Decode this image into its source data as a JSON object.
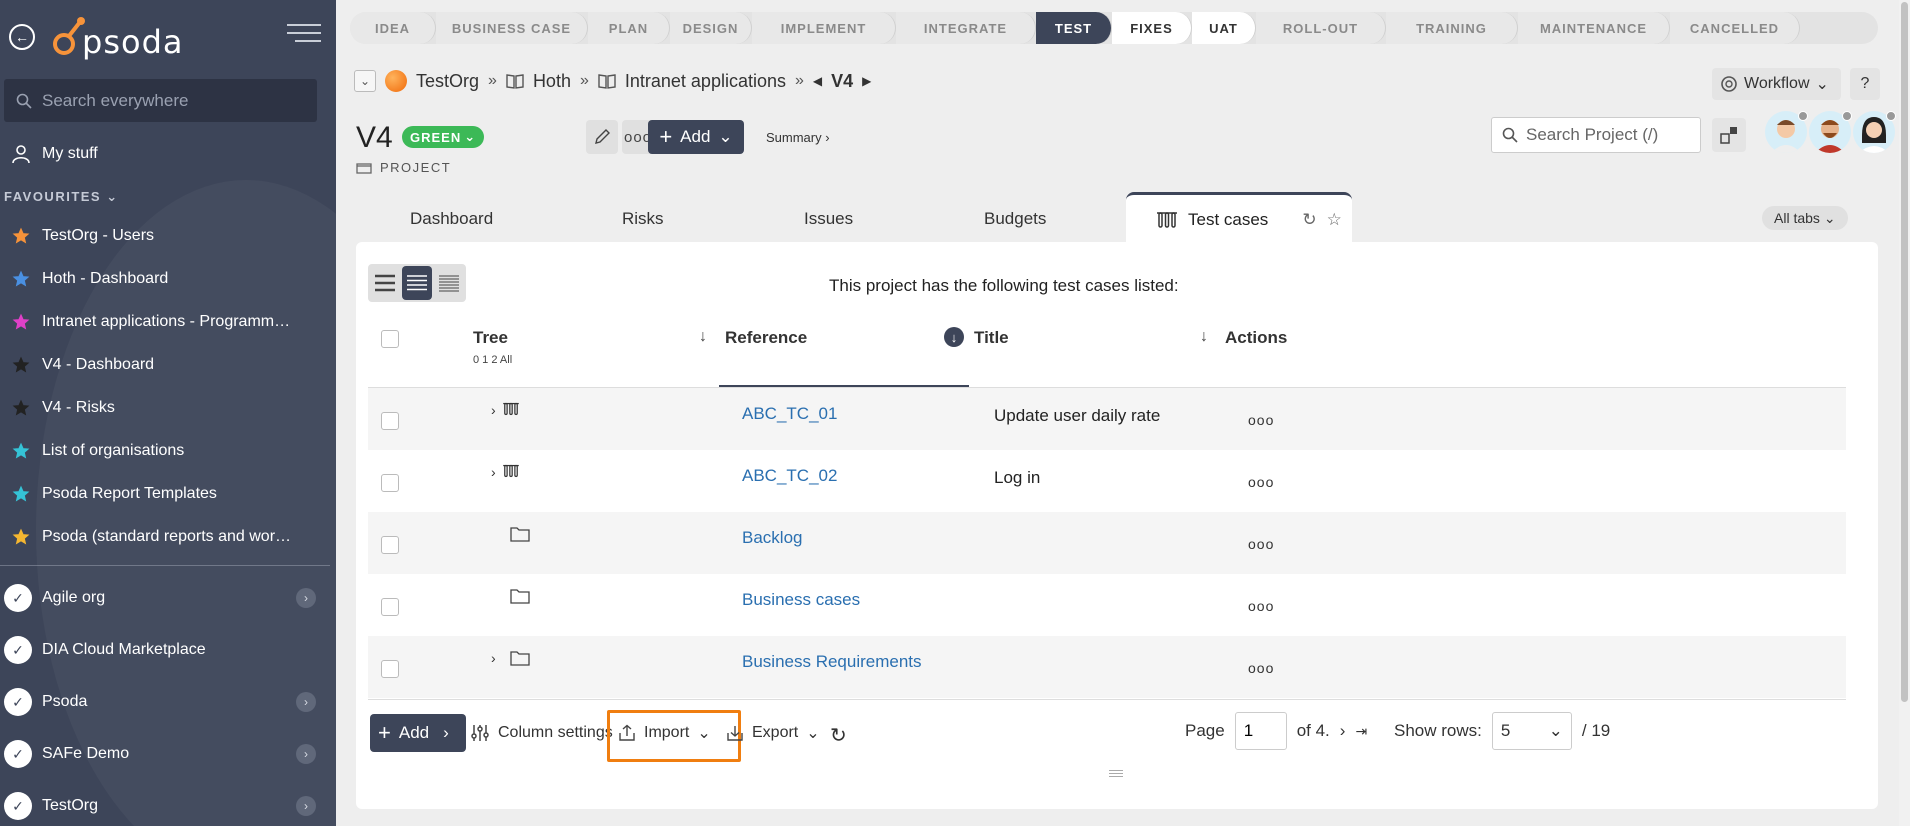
{
  "sidebar": {
    "logo_text": "psoda",
    "search_placeholder": "Search everywhere",
    "my_stuff": "My stuff",
    "favourites_label": "FAVOURITES",
    "favourites": [
      {
        "label": "TestOrg - Users",
        "star_color": "#f7933a"
      },
      {
        "label": "Hoth - Dashboard",
        "star_color": "#4a90e2"
      },
      {
        "label": "Intranet applications - Programme...",
        "star_color": "#e040c8"
      },
      {
        "label": "V4 - Dashboard",
        "star_color": "#222222"
      },
      {
        "label": "V4 - Risks",
        "star_color": "#222222"
      },
      {
        "label": "List of organisations",
        "star_color": "#35c3d6"
      },
      {
        "label": "Psoda Report Templates",
        "star_color": "#35c3d6"
      },
      {
        "label": "Psoda (standard reports and work...",
        "star_color": "#f5b731"
      }
    ],
    "orgs": [
      {
        "label": "Agile org"
      },
      {
        "label": "DIA Cloud Marketplace"
      },
      {
        "label": "Psoda"
      },
      {
        "label": "SAFe Demo"
      },
      {
        "label": "TestOrg"
      }
    ]
  },
  "phases": [
    "IDEA",
    "BUSINESS CASE",
    "PLAN",
    "DESIGN",
    "IMPLEMENT",
    "INTEGRATE",
    "TEST",
    "FIXES",
    "UAT",
    "ROLL-OUT",
    "TRAINING",
    "MAINTENANCE",
    "CANCELLED"
  ],
  "active_phase": "TEST",
  "breadcrumb": {
    "org": "TestOrg",
    "sep": "»",
    "programme": "Hoth",
    "project_group": "Intranet applications",
    "current": "V4"
  },
  "header": {
    "workflow_label": "Workflow",
    "help_label": "?",
    "project_name": "V4",
    "status": "GREEN",
    "project_type": "PROJECT",
    "add_label": "Add",
    "summary_link": "Summary ›",
    "search_placeholder": "Search Project (/)"
  },
  "tabs": [
    "Dashboard",
    "Risks",
    "Issues",
    "Budgets"
  ],
  "active_tab": "Test cases",
  "all_tabs_label": "All tabs",
  "list": {
    "caption": "This project has the following test cases listed:",
    "columns": {
      "tree": "Tree",
      "tree_levels": "0 1 2 All",
      "reference": "Reference",
      "title": "Title",
      "actions": "Actions"
    },
    "rows": [
      {
        "reference": "ABC_TC_01",
        "title": "Update user daily rate",
        "type": "test-case",
        "expandable": true
      },
      {
        "reference": "ABC_TC_02",
        "title": "Log in",
        "type": "test-case",
        "expandable": true
      },
      {
        "reference": "Backlog",
        "title": "",
        "type": "folder",
        "expandable": false
      },
      {
        "reference": "Business cases",
        "title": "",
        "type": "folder",
        "expandable": false
      },
      {
        "reference": "Business Requirements",
        "title": "",
        "type": "folder",
        "expandable": true
      }
    ],
    "actions_glyph": "ooo"
  },
  "footer": {
    "add_label": "Add",
    "column_settings": "Column settings",
    "import_label": "Import",
    "export_label": "Export",
    "page_label": "Page",
    "page_value": "1",
    "of_label": "of 4.",
    "show_rows_label": "Show rows:",
    "rows_value": "5",
    "total_label": "/ 19"
  },
  "colors": {
    "sidebar_bg": "#3d4559",
    "accent": "#3d4559",
    "status_green": "#3cb957",
    "link": "#2a6fb0",
    "highlight": "#f07e10"
  }
}
